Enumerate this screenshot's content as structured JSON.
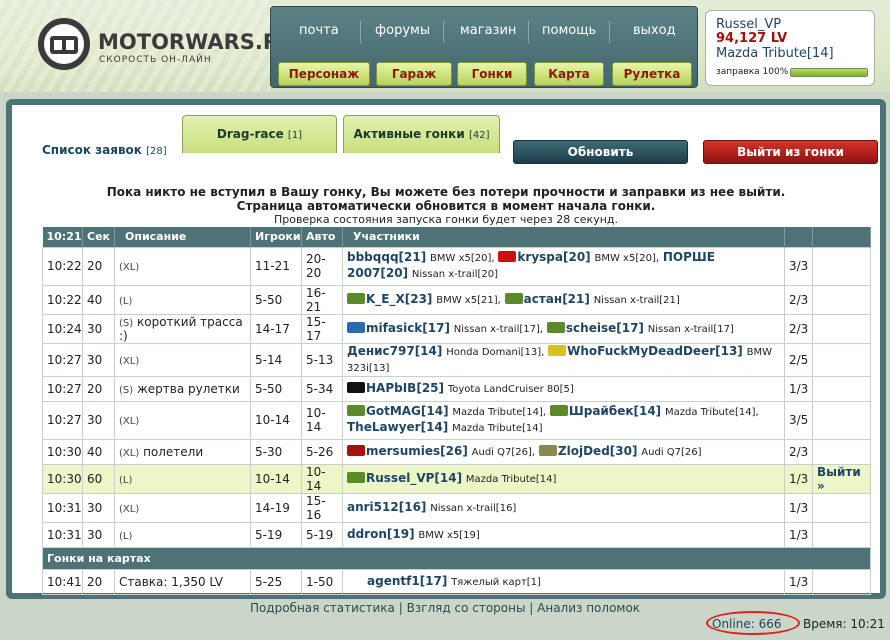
{
  "header": {
    "logo_title": "MOTORWARS.RU",
    "logo_subtitle": "СКОРОСТЬ ОН-ЛАЙН",
    "top_nav": [
      "почта",
      "форумы",
      "магазин",
      "помощь",
      "выход"
    ],
    "sub_nav": [
      "Персонаж",
      "Гараж",
      "Гонки",
      "Карта",
      "Рулетка"
    ]
  },
  "user": {
    "name": "Russel_VP",
    "money": "94,127 LV",
    "car": "Mazda Tribute[14]",
    "fuel_label": "заправка 100%",
    "fuel_percent": 100
  },
  "panel": {
    "list_label": "Список заявок",
    "list_count": "[28]",
    "tab1_label": "Drag-race",
    "tab1_count": "[1]",
    "tab2_label": "Активные гонки",
    "tab2_count": "[42]",
    "refresh_button": "Обновить",
    "exit_race_button": "Выйти из гонки",
    "notice_line1": "Пока никто не вступил в Вашу гонку, Вы можете без потери прочности и заправки из нее выйти.",
    "notice_line2": "Страница автоматически обновится в момент начала гонки.",
    "notice_line3": "Проверка состояния запуска гонки будет через 28 секунд."
  },
  "table": {
    "headers": [
      "10:21",
      "Сек",
      "Описание",
      "Игроки",
      "Авто",
      "Участники"
    ],
    "rows": [
      {
        "time": "10:22",
        "sec": "20",
        "cls": "(XL)",
        "desc": "",
        "players": "11-21",
        "auto": "20-20",
        "count": "3/3",
        "participants": [
          {
            "name": "bbbqqq",
            "lvl": "[21]",
            "car": "BMW x5[20],",
            "clan": ""
          },
          {
            "name": "kryspa",
            "lvl": "[20]",
            "car": "BMW x5[20],",
            "clan": "#cc1010"
          },
          {
            "name": "ПОРШЕ 2007",
            "lvl": "[20]",
            "car": "Nissan x-trail[20]",
            "clan": ""
          }
        ]
      },
      {
        "time": "10:22",
        "sec": "40",
        "cls": "(L)",
        "desc": "",
        "players": "5-50",
        "auto": "16-21",
        "count": "2/3",
        "participants": [
          {
            "name": "K_E_X",
            "lvl": "[23]",
            "car": "BMW x5[21],",
            "clan": "#5a8a2a"
          },
          {
            "name": "астан",
            "lvl": "[21]",
            "car": "Nissan x-trail[21]",
            "clan": "#5a8a2a"
          }
        ]
      },
      {
        "time": "10:24",
        "sec": "30",
        "cls": "(S)",
        "desc": "короткий трасса :)",
        "players": "14-17",
        "auto": "15-17",
        "count": "2/3",
        "participants": [
          {
            "name": "mifasick",
            "lvl": "[17]",
            "car": "Nissan x-trail[17],",
            "clan": "#2a6bb0"
          },
          {
            "name": "scheise",
            "lvl": "[17]",
            "car": "Nissan x-trail[17]",
            "clan": "#5a8a2a"
          }
        ]
      },
      {
        "time": "10:27",
        "sec": "30",
        "cls": "(XL)",
        "desc": "",
        "players": "5-14",
        "auto": "5-13",
        "count": "2/5",
        "participants": [
          {
            "name": "Денис797",
            "lvl": "[14]",
            "car": "Honda Domani[13],",
            "clan": ""
          },
          {
            "name": "WhoFuckMyDeadDeer",
            "lvl": "[13]",
            "car": "BMW 323i[13]",
            "clan": "#d8c020"
          }
        ]
      },
      {
        "time": "10:27",
        "sec": "20",
        "cls": "(S)",
        "desc": "жертва рулетки",
        "players": "5-50",
        "auto": "5-34",
        "count": "1/3",
        "participants": [
          {
            "name": "HAPbIB",
            "lvl": "[25]",
            "car": "Toyota LandCruiser 80[5]",
            "clan": "#111111"
          }
        ]
      },
      {
        "time": "10:27",
        "sec": "30",
        "cls": "(XL)",
        "desc": "",
        "players": "10-14",
        "auto": "10-14",
        "count": "3/5",
        "participants": [
          {
            "name": "GotMAG",
            "lvl": "[14]",
            "car": "Mazda Tribute[14],",
            "clan": "#5a8a2a"
          },
          {
            "name": "Шрайбек",
            "lvl": "[14]",
            "car": "Mazda Tribute[14],",
            "clan": "#5a8a2a"
          },
          {
            "name": "TheLawyer",
            "lvl": "[14]",
            "car": "Mazda Tribute[14]",
            "clan": ""
          }
        ]
      },
      {
        "time": "10:30",
        "sec": "40",
        "cls": "(XL)",
        "desc": "полетели",
        "players": "5-30",
        "auto": "5-26",
        "count": "2/3",
        "participants": [
          {
            "name": "mersumies",
            "lvl": "[26]",
            "car": "Audi Q7[26],",
            "clan": "#aa1010"
          },
          {
            "name": "ZlojDed",
            "lvl": "[30]",
            "car": "Audi Q7[26]",
            "clan": "#8a8a50"
          }
        ]
      },
      {
        "time": "10:30",
        "sec": "60",
        "cls": "(L)",
        "desc": "",
        "players": "10-14",
        "auto": "10-14",
        "count": "1/3",
        "mine": true,
        "action": "Выйти »",
        "participants": [
          {
            "name": "Russel_VP",
            "lvl": "[14]",
            "car": "Mazda Tribute[14]",
            "clan": "#5a8a2a"
          }
        ]
      },
      {
        "time": "10:31",
        "sec": "30",
        "cls": "(XL)",
        "desc": "",
        "players": "14-19",
        "auto": "15-16",
        "count": "1/3",
        "participants": [
          {
            "name": "anri512",
            "lvl": "[16]",
            "car": "Nissan x-trail[16]",
            "clan": ""
          }
        ]
      },
      {
        "time": "10:31",
        "sec": "30",
        "cls": "(L)",
        "desc": "",
        "players": "5-19",
        "auto": "5-19",
        "count": "1/3",
        "participants": [
          {
            "name": "ddron",
            "lvl": "[19]",
            "car": "BMW x5[19]",
            "clan": ""
          }
        ]
      }
    ],
    "section_title": "Гонки на картах",
    "map_rows": [
      {
        "time": "10:41",
        "sec": "20",
        "desc": "Ставка: 1,350 LV",
        "players": "5-25",
        "auto": "1-50",
        "count": "1/3",
        "participants": [
          {
            "name": "agentf1",
            "lvl": "[17]",
            "car": "Тяжелый карт[1]",
            "clan": ""
          }
        ]
      }
    ]
  },
  "footer": {
    "links": "Подробная статистика | Взгляд со стороны | Анализ поломок",
    "online": "Online: 666",
    "time": "Время: 10:21"
  }
}
